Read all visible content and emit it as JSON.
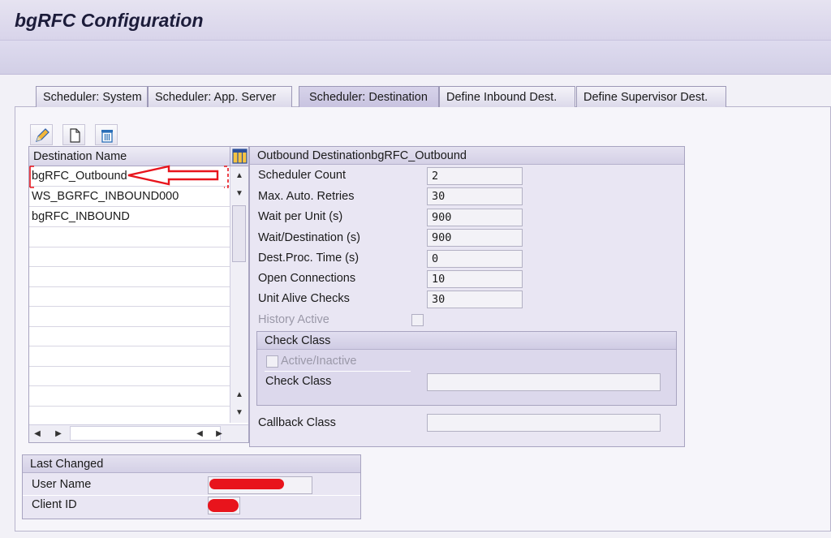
{
  "window": {
    "title": "bgRFC Configuration"
  },
  "tabs": [
    {
      "label": "Scheduler: System",
      "active": false
    },
    {
      "label": "Scheduler: App. Server",
      "active": false
    },
    {
      "label": "Scheduler: Destination",
      "active": true
    },
    {
      "label": "Define Inbound Dest.",
      "active": false
    },
    {
      "label": "Define Supervisor Dest.",
      "active": false
    }
  ],
  "toolbar_icons": [
    "pencil-icon",
    "new-document-icon",
    "trash-icon"
  ],
  "destination_table": {
    "header": "Destination Name",
    "rows": [
      "bgRFC_Outbound",
      "WS_BGRFC_INBOUND000",
      "bgRFC_INBOUND"
    ],
    "selected_row": "bgRFC_Outbound"
  },
  "outbound": {
    "title": "Outbound DestinationbgRFC_Outbound",
    "fields": {
      "scheduler_count": {
        "label": "Scheduler Count",
        "value": "2"
      },
      "max_retries": {
        "label": "Max. Auto. Retries",
        "value": "30"
      },
      "wait_per_unit": {
        "label": "Wait per Unit (s)",
        "value": "900"
      },
      "wait_destination": {
        "label": "Wait/Destination (s)",
        "value": "900"
      },
      "dest_proc_time": {
        "label": "Dest.Proc. Time (s)",
        "value": "0"
      },
      "open_connections": {
        "label": "Open Connections",
        "value": "10"
      },
      "unit_alive_checks": {
        "label": "Unit Alive Checks",
        "value": "30"
      }
    },
    "history_active": {
      "label": "History Active",
      "checked": false
    },
    "check_class_group": {
      "title": "Check Class",
      "active_inactive_label": "Active/Inactive",
      "check_class_label": "Check Class",
      "check_class_value": ""
    },
    "callback_class": {
      "label": "Callback Class",
      "value": ""
    }
  },
  "last_changed": {
    "title": "Last Changed",
    "user_name_label": "User Name",
    "client_id_label": "Client ID"
  },
  "colors": {
    "annotation_red": "#e8141c",
    "panel_lavender": "#e9e6f3"
  }
}
